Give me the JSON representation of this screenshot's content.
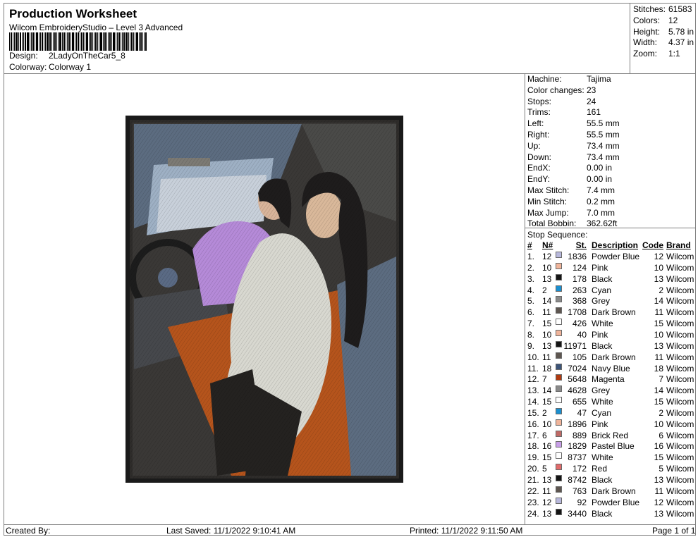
{
  "header": {
    "title": "Production Worksheet",
    "software": "Wilcom EmbroideryStudio – Level 3 Advanced",
    "design_label": "Design:",
    "design_value": "2LadyOnTheCar5_8",
    "colorway_label": "Colorway:",
    "colorway_value": "Colorway 1"
  },
  "stats": [
    {
      "label": "Stitches:",
      "value": "61583"
    },
    {
      "label": "Colors:",
      "value": "12"
    },
    {
      "label": "Height:",
      "value": "5.78 in"
    },
    {
      "label": "Width:",
      "value": "4.37 in"
    },
    {
      "label": "Zoom:",
      "value": "1:1"
    }
  ],
  "machine_info": [
    {
      "label": "Machine:",
      "value": "Tajima"
    },
    {
      "label": "Color changes:",
      "value": "23"
    },
    {
      "label": "Stops:",
      "value": "24"
    },
    {
      "label": "Trims:",
      "value": "161"
    },
    {
      "label": "Left:",
      "value": "55.5 mm"
    },
    {
      "label": "Right:",
      "value": "55.5 mm"
    },
    {
      "label": "Up:",
      "value": "73.4 mm"
    },
    {
      "label": "Down:",
      "value": "73.4 mm"
    },
    {
      "label": "EndX:",
      "value": "0.00 in"
    },
    {
      "label": "EndY:",
      "value": "0.00 in"
    },
    {
      "label": "Max Stitch:",
      "value": "7.4 mm"
    },
    {
      "label": "Min Stitch:",
      "value": "0.2 mm"
    },
    {
      "label": "Max Jump:",
      "value": "7.0 mm"
    },
    {
      "label": "Total Bobbin:",
      "value": "362.62ft"
    }
  ],
  "stop_sequence": {
    "title": "Stop Sequence:",
    "headers": {
      "num": "#",
      "needle": "N#",
      "stitches": "St.",
      "description": "Description",
      "code": "Code",
      "brand": "Brand"
    },
    "rows": [
      {
        "num": "1.",
        "needle": "12",
        "color": "#b8b8dc",
        "stitches": "1836",
        "description": "Powder Blue",
        "code": "12",
        "brand": "Wilcom"
      },
      {
        "num": "2.",
        "needle": "10",
        "color": "#f0b49a",
        "stitches": "124",
        "description": "Pink",
        "code": "10",
        "brand": "Wilcom"
      },
      {
        "num": "3.",
        "needle": "13",
        "color": "#141414",
        "stitches": "178",
        "description": "Black",
        "code": "13",
        "brand": "Wilcom"
      },
      {
        "num": "4.",
        "needle": "2",
        "color": "#1a8fd0",
        "stitches": "263",
        "description": "Cyan",
        "code": "2",
        "brand": "Wilcom"
      },
      {
        "num": "5.",
        "needle": "14",
        "color": "#8a8a8a",
        "stitches": "368",
        "description": "Grey",
        "code": "14",
        "brand": "Wilcom"
      },
      {
        "num": "6.",
        "needle": "11",
        "color": "#5e5650",
        "stitches": "1708",
        "description": "Dark Brown",
        "code": "11",
        "brand": "Wilcom"
      },
      {
        "num": "7.",
        "needle": "15",
        "color": "#ffffff",
        "stitches": "426",
        "description": "White",
        "code": "15",
        "brand": "Wilcom"
      },
      {
        "num": "8.",
        "needle": "10",
        "color": "#f0b49a",
        "stitches": "40",
        "description": "Pink",
        "code": "10",
        "brand": "Wilcom"
      },
      {
        "num": "9.",
        "needle": "13",
        "color": "#141414",
        "stitches": "11971",
        "description": "Black",
        "code": "13",
        "brand": "Wilcom"
      },
      {
        "num": "10.",
        "needle": "11",
        "color": "#5e5650",
        "stitches": "105",
        "description": "Dark Brown",
        "code": "11",
        "brand": "Wilcom"
      },
      {
        "num": "11.",
        "needle": "18",
        "color": "#3c5478",
        "stitches": "7024",
        "description": "Navy Blue",
        "code": "18",
        "brand": "Wilcom"
      },
      {
        "num": "12.",
        "needle": "7",
        "color": "#b03a10",
        "stitches": "5648",
        "description": "Magenta",
        "code": "7",
        "brand": "Wilcom"
      },
      {
        "num": "13.",
        "needle": "14",
        "color": "#8a8a8a",
        "stitches": "4628",
        "description": "Grey",
        "code": "14",
        "brand": "Wilcom"
      },
      {
        "num": "14.",
        "needle": "15",
        "color": "#ffffff",
        "stitches": "655",
        "description": "White",
        "code": "15",
        "brand": "Wilcom"
      },
      {
        "num": "15.",
        "needle": "2",
        "color": "#1a8fd0",
        "stitches": "47",
        "description": "Cyan",
        "code": "2",
        "brand": "Wilcom"
      },
      {
        "num": "16.",
        "needle": "10",
        "color": "#f0b49a",
        "stitches": "1896",
        "description": "Pink",
        "code": "10",
        "brand": "Wilcom"
      },
      {
        "num": "17.",
        "needle": "6",
        "color": "#c06a66",
        "stitches": "889",
        "description": "Brick Red",
        "code": "6",
        "brand": "Wilcom"
      },
      {
        "num": "18.",
        "needle": "16",
        "color": "#c89ee8",
        "stitches": "1829",
        "description": "Pastel Blue",
        "code": "16",
        "brand": "Wilcom"
      },
      {
        "num": "19.",
        "needle": "15",
        "color": "#ffffff",
        "stitches": "8737",
        "description": "White",
        "code": "15",
        "brand": "Wilcom"
      },
      {
        "num": "20.",
        "needle": "5",
        "color": "#e06a6a",
        "stitches": "172",
        "description": "Red",
        "code": "5",
        "brand": "Wilcom"
      },
      {
        "num": "21.",
        "needle": "13",
        "color": "#141414",
        "stitches": "8742",
        "description": "Black",
        "code": "13",
        "brand": "Wilcom"
      },
      {
        "num": "22.",
        "needle": "11",
        "color": "#5e5650",
        "stitches": "763",
        "description": "Dark Brown",
        "code": "11",
        "brand": "Wilcom"
      },
      {
        "num": "23.",
        "needle": "12",
        "color": "#b8b8dc",
        "stitches": "92",
        "description": "Powder Blue",
        "code": "12",
        "brand": "Wilcom"
      },
      {
        "num": "24.",
        "needle": "13",
        "color": "#141414",
        "stitches": "3440",
        "description": "Black",
        "code": "13",
        "brand": "Wilcom"
      }
    ]
  },
  "footer": {
    "created_by": "Created By:",
    "last_saved": "Last Saved: 11/1/2022 9:10:41 AM",
    "printed": "Printed: 11/1/2022 9:11:50 AM",
    "page": "Page 1 of 1"
  }
}
